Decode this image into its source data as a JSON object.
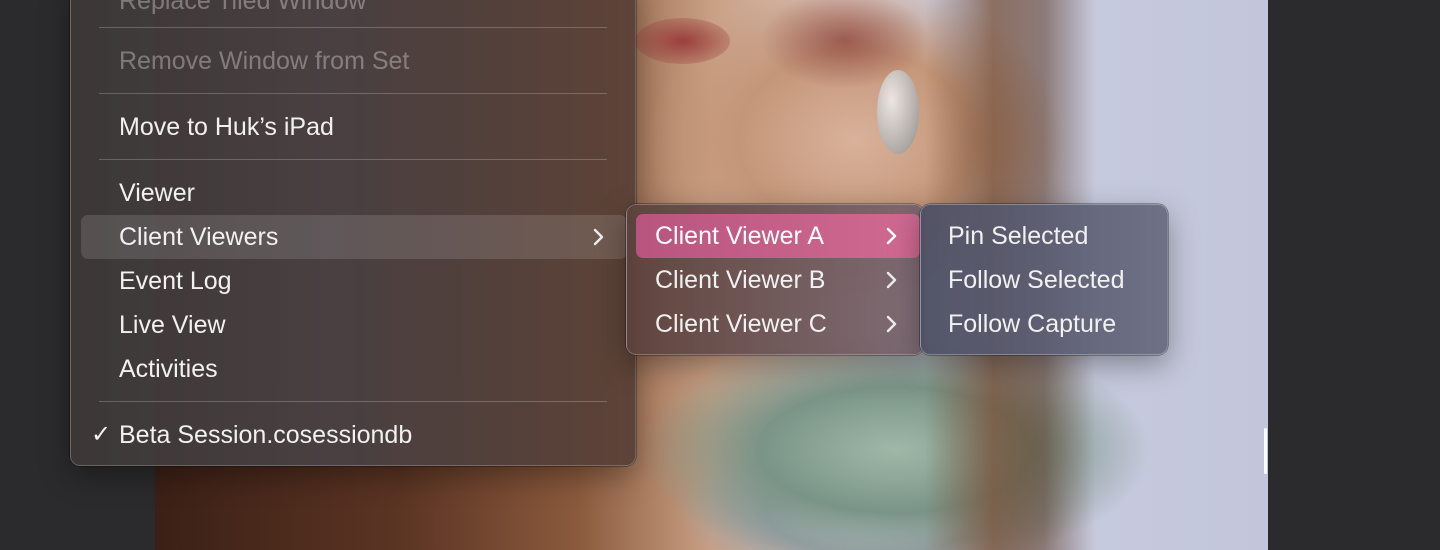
{
  "main_menu": {
    "items": [
      {
        "label": "Replace Tiled Window",
        "enabled": false
      },
      {
        "label": "Remove Window from Set",
        "enabled": false
      },
      {
        "label": "Move to Huk’s iPad",
        "enabled": true
      },
      {
        "label": "Viewer",
        "enabled": true
      },
      {
        "label": "Client Viewers",
        "enabled": true,
        "has_submenu": true,
        "state": "hover"
      },
      {
        "label": "Event Log",
        "enabled": true
      },
      {
        "label": "Live View",
        "enabled": true
      },
      {
        "label": "Activities",
        "enabled": true
      },
      {
        "label": "Beta Session.cosessiondb",
        "enabled": true,
        "checked": true,
        "check_glyph": "✓"
      }
    ]
  },
  "client_viewers_menu": {
    "items": [
      {
        "label": "Client Viewer A",
        "has_submenu": true,
        "state": "selected"
      },
      {
        "label": "Client Viewer B",
        "has_submenu": true
      },
      {
        "label": "Client Viewer C",
        "has_submenu": true
      }
    ]
  },
  "client_viewer_a_menu": {
    "items": [
      {
        "label": "Pin Selected"
      },
      {
        "label": "Follow Selected"
      },
      {
        "label": "Follow Capture"
      }
    ]
  },
  "colors": {
    "selected_highlight": "#c45f88",
    "menu_text": "#f1f1f1",
    "disabled_text": "#8a8585"
  },
  "icons": {
    "submenu_arrow": "chevron-right-icon",
    "checkmark": "checkmark-icon"
  }
}
